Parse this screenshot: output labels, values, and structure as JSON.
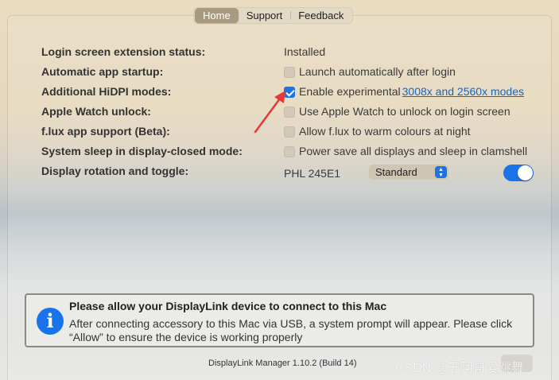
{
  "tabs": [
    {
      "label": "Home",
      "active": true
    },
    {
      "label": "Support",
      "active": false
    },
    {
      "label": "Feedback",
      "active": false
    }
  ],
  "settings": [
    {
      "label": "Login screen extension status:",
      "value": "Installed"
    },
    {
      "label": "Automatic app startup:",
      "checkbox_label": "Launch automatically after login",
      "checked": false
    },
    {
      "label": "Additional HiDPI modes:",
      "checkbox_label": "Enable experimental",
      "link": "3008x and 2560x modes",
      "checked": true
    },
    {
      "label": "Apple Watch unlock:",
      "checkbox_label": "Use Apple Watch to unlock on login screen",
      "checked": false
    },
    {
      "label": "f.lux app support (Beta):",
      "checkbox_label": "Allow f.lux to warm colours at night",
      "checked": false
    },
    {
      "label": "System sleep in display-closed mode:",
      "checkbox_label": "Power save all displays and sleep in clamshell",
      "checked": false
    },
    {
      "label": "Display rotation and toggle:",
      "display_name": "PHL 245E1",
      "rotation_value": "Standard",
      "toggle_on": true
    }
  ],
  "notice": {
    "title": "Please allow your DisplayLink device to connect to this Mac",
    "body": "After connecting accessory to this Mac via USB, a system prompt will appear. Please click “Allow” to ensure the device is working properly",
    "icon": "info-icon"
  },
  "footer": {
    "version": "DisplayLink Manager 1.10.2 (Build 14)"
  },
  "watermark": "CSDN @五阿哥爱跳舞",
  "colors": {
    "accent": "#1a73e8",
    "annotation_arrow": "#e53935"
  }
}
